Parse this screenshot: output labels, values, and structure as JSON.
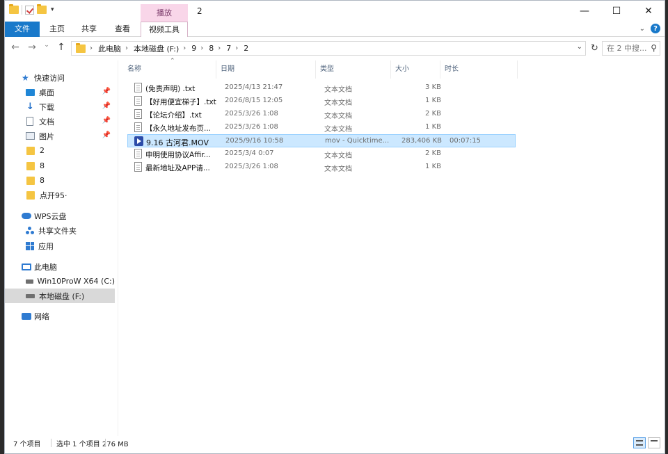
{
  "window": {
    "title": "2",
    "contextual_group": "播放"
  },
  "ribbon": {
    "tabs": [
      {
        "label": "文件"
      },
      {
        "label": "主页"
      },
      {
        "label": "共享"
      },
      {
        "label": "查看"
      },
      {
        "label": "视频工具"
      }
    ]
  },
  "address": {
    "crumbs": [
      "此电脑",
      "本地磁盘 (F:)",
      "9",
      "8",
      "7",
      "2"
    ],
    "search_placeholder": "在 2 中搜..."
  },
  "sidebar": {
    "quick_access": "快速访问",
    "items": [
      {
        "label": "桌面",
        "icon": "desktop-icon",
        "pinned": true
      },
      {
        "label": "下载",
        "icon": "download-icon",
        "pinned": true
      },
      {
        "label": "文档",
        "icon": "documents-icon",
        "pinned": true
      },
      {
        "label": "图片",
        "icon": "pictures-icon",
        "pinned": true
      },
      {
        "label": "2",
        "icon": "folder-icon"
      },
      {
        "label": "8",
        "icon": "folder-icon"
      },
      {
        "label": "8",
        "icon": "folder-icon"
      },
      {
        "label": "点开95·",
        "icon": "folder-icon"
      }
    ],
    "wps_cloud": "WPS云盘",
    "shared_folder": "共享文件夹",
    "apps": "应用",
    "this_pc": "此电脑",
    "drives": [
      {
        "label": "Win10ProW X64 (C:)"
      },
      {
        "label": "本地磁盘 (F:)",
        "selected": true
      }
    ],
    "network": "网络"
  },
  "columns": {
    "name": "名称",
    "date": "日期",
    "type": "类型",
    "size": "大小",
    "duration": "时长"
  },
  "files": [
    {
      "name": "(免责声明) .txt",
      "date": "2025/4/13 21:47",
      "type": "文本文档",
      "size": "3 KB",
      "duration": "",
      "kind": "txt"
    },
    {
      "name": "【好用便宜梯子】.txt",
      "date": "2026/8/15 12:05",
      "type": "文本文档",
      "size": "1 KB",
      "duration": "",
      "kind": "txt"
    },
    {
      "name": "【论坛介绍】.txt",
      "date": "2025/3/26 1:08",
      "type": "文本文档",
      "size": "2 KB",
      "duration": "",
      "kind": "txt"
    },
    {
      "name": "【永久地址发布页...",
      "date": "2025/3/26 1:08",
      "type": "文本文档",
      "size": "1 KB",
      "duration": "",
      "kind": "txt"
    },
    {
      "name": "9.16 古河君.MOV",
      "date": "2025/9/16 10:58",
      "type": "mov - Quicktime...",
      "size": "283,406 KB",
      "duration": "00:07:15",
      "kind": "mov",
      "selected": true
    },
    {
      "name": "申明使用协议Affir...",
      "date": "2025/3/4 0:07",
      "type": "文本文档",
      "size": "2 KB",
      "duration": "",
      "kind": "txt"
    },
    {
      "name": "最新地址及APP请...",
      "date": "2025/3/26 1:08",
      "type": "文本文档",
      "size": "1 KB",
      "duration": "",
      "kind": "txt"
    }
  ],
  "status": {
    "item_count": "7 个项目",
    "selection": "选中 1 个项目  276 MB"
  }
}
